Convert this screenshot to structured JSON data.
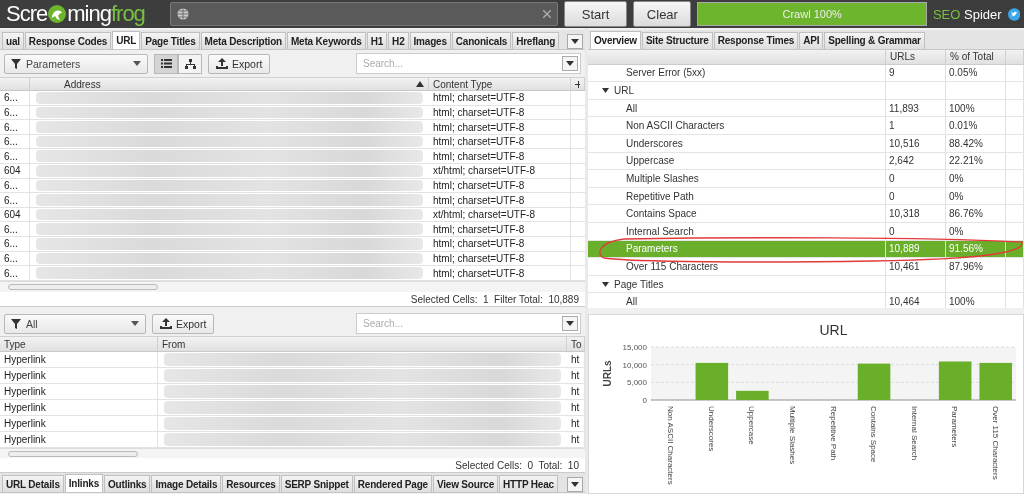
{
  "header": {
    "logo": {
      "left": "Scre",
      "right": "ming",
      "accent": "frog"
    },
    "buttons": [
      "Start",
      "Clear"
    ],
    "progress": {
      "label": "Crawl 100%",
      "level": 1
    },
    "product": {
      "accent": "SEO",
      "text": "Spider"
    }
  },
  "main": {
    "tabs": [
      {
        "label": "ual",
        "selected": false
      },
      {
        "label": "Response Codes",
        "selected": false
      },
      {
        "label": "URL",
        "selected": true
      },
      {
        "label": "Page Titles",
        "selected": false
      },
      {
        "label": "Meta Description",
        "selected": false
      },
      {
        "label": "Meta Keywords",
        "selected": false
      },
      {
        "label": "H1",
        "selected": false
      },
      {
        "label": "H2",
        "selected": false
      },
      {
        "label": "Images",
        "selected": false
      },
      {
        "label": "Canonicals",
        "selected": false
      },
      {
        "label": "Hreflang",
        "selected": false
      }
    ],
    "filter": "Parameters",
    "views": [
      {
        "kind": "list",
        "selected": true
      },
      {
        "kind": "tree",
        "selected": false
      }
    ],
    "export": "Export",
    "search": {
      "placeholder": "Search..."
    },
    "columns": [
      "Address",
      "Content Type"
    ],
    "rows": [
      {
        "column_1": "6...",
        "content_type": "html; charset=UTF-8"
      },
      {
        "column_1": "6...",
        "content_type": "html; charset=UTF-8"
      },
      {
        "column_1": "6...",
        "content_type": "html; charset=UTF-8"
      },
      {
        "column_1": "6...",
        "content_type": "html; charset=UTF-8"
      },
      {
        "column_1": "6...",
        "content_type": "html; charset=UTF-8"
      },
      {
        "column_1": "604",
        "content_type": "xt/html; charset=UTF-8"
      },
      {
        "column_1": "6...",
        "content_type": "html; charset=UTF-8"
      },
      {
        "column_1": "6...",
        "content_type": "html; charset=UTF-8"
      },
      {
        "column_1": "604",
        "content_type": "xt/html; charset=UTF-8"
      },
      {
        "column_1": "6...",
        "content_type": "html; charset=UTF-8"
      },
      {
        "column_1": "6...",
        "content_type": "html; charset=UTF-8"
      },
      {
        "column_1": "6...",
        "content_type": "html; charset=UTF-8"
      },
      {
        "column_1": "6...",
        "content_type": "html; charset=UTF-8"
      }
    ],
    "status": "Selected Cells:  1  Filter Total:  10,889"
  },
  "detail": {
    "filter": "All",
    "export": "Export",
    "search": {
      "placeholder": "Search..."
    },
    "columns": [
      "Type",
      "From",
      "To"
    ],
    "rows": [
      {
        "type": "Hyperlink",
        "to": "ht"
      },
      {
        "type": "Hyperlink",
        "to": "ht"
      },
      {
        "type": "Hyperlink",
        "to": "ht"
      },
      {
        "type": "Hyperlink",
        "to": "ht"
      },
      {
        "type": "Hyperlink",
        "to": "ht"
      },
      {
        "type": "Hyperlink",
        "to": "ht"
      }
    ],
    "status": "Selected Cells:  0  Total:  10",
    "tabs": [
      {
        "label": "URL Details",
        "selected": false
      },
      {
        "label": "Inlinks",
        "selected": true
      },
      {
        "label": "Outlinks",
        "selected": false
      },
      {
        "label": "Image Details",
        "selected": false
      },
      {
        "label": "Resources",
        "selected": false
      },
      {
        "label": "SERP Snippet",
        "selected": false
      },
      {
        "label": "Rendered Page",
        "selected": false
      },
      {
        "label": "View Source",
        "selected": false
      },
      {
        "label": "HTTP Heac",
        "selected": false
      }
    ]
  },
  "overview": {
    "tabs": [
      {
        "label": "Overview",
        "selected": true
      },
      {
        "label": "Site Structure",
        "selected": false
      },
      {
        "label": "Response Times",
        "selected": false
      },
      {
        "label": "API",
        "selected": false
      },
      {
        "label": "Spelling & Grammar",
        "selected": false
      }
    ],
    "columns": [
      "URLs",
      "% of Total"
    ],
    "rows": [
      {
        "label": "Server Error (5xx)",
        "urls": "9",
        "percent": "0.05%",
        "selected": false
      },
      {
        "label": "URL",
        "expanded": true,
        "children": [
          {
            "label": "All",
            "urls": "11,893",
            "percent": "100%",
            "selected": false
          },
          {
            "label": "Non ASCII Characters",
            "urls": "1",
            "percent": "0.01%",
            "selected": false
          },
          {
            "label": "Underscores",
            "urls": "10,516",
            "percent": "88.42%",
            "selected": false
          },
          {
            "label": "Uppercase",
            "urls": "2,642",
            "percent": "22.21%",
            "selected": false
          },
          {
            "label": "Multiple Slashes",
            "urls": "0",
            "percent": "0%",
            "selected": false
          },
          {
            "label": "Repetitive Path",
            "urls": "0",
            "percent": "0%",
            "selected": false
          },
          {
            "label": "Contains Space",
            "urls": "10,318",
            "percent": "86.76%",
            "selected": false
          },
          {
            "label": "Internal Search",
            "urls": "0",
            "percent": "0%",
            "selected": false
          },
          {
            "label": "Parameters",
            "urls": "10,889",
            "percent": "91.56%",
            "selected": true
          },
          {
            "label": "Over 115 Characters",
            "urls": "10,461",
            "percent": "87.96%",
            "selected": false
          }
        ]
      },
      {
        "label": "Page Titles",
        "expanded": true,
        "children": [
          {
            "label": "All",
            "urls": "10,464",
            "percent": "100%",
            "selected": false
          }
        ]
      }
    ],
    "chart_data": {
      "type": "bar",
      "title": "URL",
      "ylabel": "URLs",
      "categories": [
        "Non ASCII Characters",
        "Underscores",
        "Uppercase",
        "Multiple Slashes",
        "Repetitive Path",
        "Contains Space",
        "Internal Search",
        "Parameters",
        "Over 115 Characters"
      ],
      "series": [
        {
          "color": "#6aaf2a",
          "values": [
            0,
            10500,
            2600,
            0,
            0,
            10300,
            0,
            10900,
            10500
          ]
        }
      ],
      "ylim": [
        0,
        15000
      ],
      "yticks": [
        {
          "value": 0,
          "label": "0"
        },
        {
          "value": 5000,
          "label": "5,000"
        },
        {
          "value": 10000,
          "label": "10,000"
        },
        {
          "value": 15000,
          "label": "15,000"
        }
      ]
    }
  }
}
